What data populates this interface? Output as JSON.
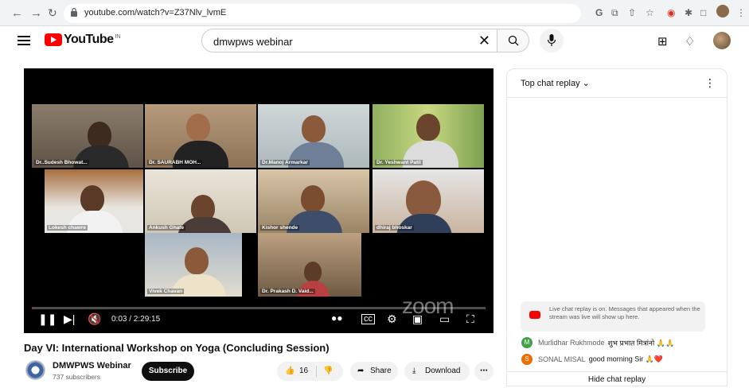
{
  "browser": {
    "url": "youtube.com/watch?v=Z37Nlv_lvmE",
    "ext_g": "G"
  },
  "youtube": {
    "logo": "YouTube",
    "country": "IN",
    "search_value": "dmwpws webinar"
  },
  "video": {
    "participants": [
      {
        "name": "Dr..Sudesh Bhowat..."
      },
      {
        "name": "Dr. SAURABH MOH..."
      },
      {
        "name": "Dr.Manoj Armarkar"
      },
      {
        "name": "Dr. Yeshwant Patil"
      },
      {
        "name": "Lokesh chawre"
      },
      {
        "name": "Ankush Ghate"
      },
      {
        "name": "Kishor shende"
      },
      {
        "name": "dhiraj bhoskar"
      },
      {
        "name": "Vivek Chavan"
      },
      {
        "name": "Dr. Prakash D. Vaid..."
      }
    ],
    "watermark": "zoom",
    "time": "0:03 / 2:29:15",
    "progress": 0.0003,
    "title": "Day VI: International Workshop on Yoga (Concluding Session)"
  },
  "channel": {
    "name": "DMWPWS Webinar",
    "subscribers": "737 subscribers",
    "subscribe_label": "Subscribe",
    "likes": "16",
    "share_label": "Share",
    "download_label": "Download"
  },
  "chat": {
    "header": "Top chat replay",
    "notice": "Live chat replay is on. Messages that appeared when the stream was live will show up here.",
    "messages": [
      {
        "initial": "M",
        "author": "Murlidhar Rukhmode",
        "text": "शुभ प्रभात मित्रांनो 🙏🙏",
        "color": "#43a047"
      },
      {
        "initial": "S",
        "author": "SONAL MISAL",
        "text": "good morning Sir 🙏❤️",
        "color": "#ef6c00"
      }
    ],
    "hide_label": "Hide chat replay"
  }
}
